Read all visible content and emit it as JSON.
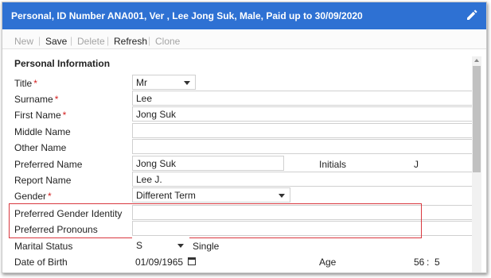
{
  "header": {
    "title": "Personal, ID Number ANA001, Ver , Lee Jong Suk, Male, Paid up to 30/09/2020",
    "edit_icon": "pencil-icon"
  },
  "toolbar": {
    "new_label": "New",
    "save_label": "Save",
    "delete_label": "Delete",
    "refresh_label": "Refresh",
    "clone_label": "Clone",
    "separator": "|"
  },
  "section": {
    "title": "Personal Information"
  },
  "required_marker": "*",
  "form": {
    "title": {
      "label": "Title",
      "value": "Mr"
    },
    "surname": {
      "label": "Surname",
      "value": "Lee"
    },
    "first_name": {
      "label": "First Name",
      "value": "Jong Suk"
    },
    "middle_name": {
      "label": "Middle Name",
      "value": ""
    },
    "other_name": {
      "label": "Other Name",
      "value": ""
    },
    "preferred_name": {
      "label": "Preferred Name",
      "value": "Jong Suk"
    },
    "initials": {
      "label": "Initials",
      "value": "J"
    },
    "report_name": {
      "label": "Report Name",
      "value": "Lee J."
    },
    "gender": {
      "label": "Gender",
      "value": "Different Term"
    },
    "preferred_gender_identity": {
      "label": "Preferred Gender Identity",
      "value": ""
    },
    "preferred_pronouns": {
      "label": "Preferred Pronouns",
      "value": ""
    },
    "marital_status": {
      "label": "Marital Status",
      "value": "S",
      "description": "Single"
    },
    "date_of_birth": {
      "label": "Date of Birth",
      "value": "01/09/1965",
      "calendar_icon": "calendar-icon"
    },
    "age": {
      "label": "Age",
      "years": "56",
      "separator": ":",
      "months": "5"
    }
  },
  "colors": {
    "header_bg": "#2e71d3",
    "required": "#d42121",
    "highlight": "#d9383f"
  }
}
